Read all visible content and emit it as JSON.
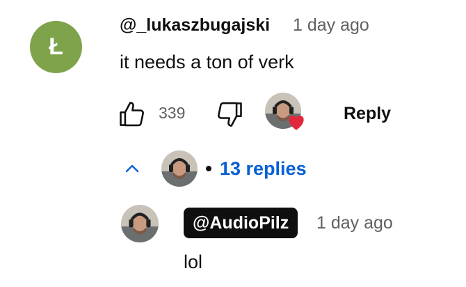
{
  "comment": {
    "avatar_letter": "Ł",
    "avatar_color": "#7fa34b",
    "author": "@_lukaszbugajski",
    "timestamp": "1 day ago",
    "text": "it needs a ton of verk",
    "like_count": "339",
    "reply_label": "Reply"
  },
  "replies": {
    "count_label": "13 replies",
    "toggle_icon": "chevron-up-icon",
    "accent_color": "#065fd4"
  },
  "reply": {
    "author": "@AudioPilz",
    "timestamp": "1 day ago",
    "text": "lol"
  },
  "icons": {
    "like": "thumb-up-icon",
    "dislike": "thumb-down-icon",
    "creator_heart": "heart-icon"
  }
}
